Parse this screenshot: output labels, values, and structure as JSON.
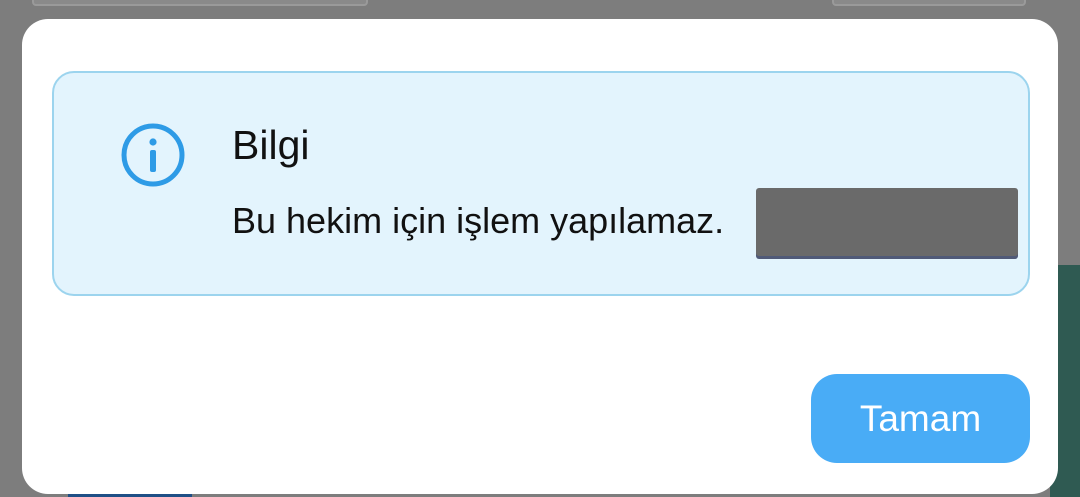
{
  "dialog": {
    "title": "Bilgi",
    "message": "Bu hekim için işlem yapılamaz.",
    "icon": "info-circle-icon",
    "ok_label": "Tamam"
  },
  "colors": {
    "info_background": "#e3f4fd",
    "info_border": "#9cd4ee",
    "icon_blue": "#2e9be6",
    "button_blue": "#49acf6"
  }
}
